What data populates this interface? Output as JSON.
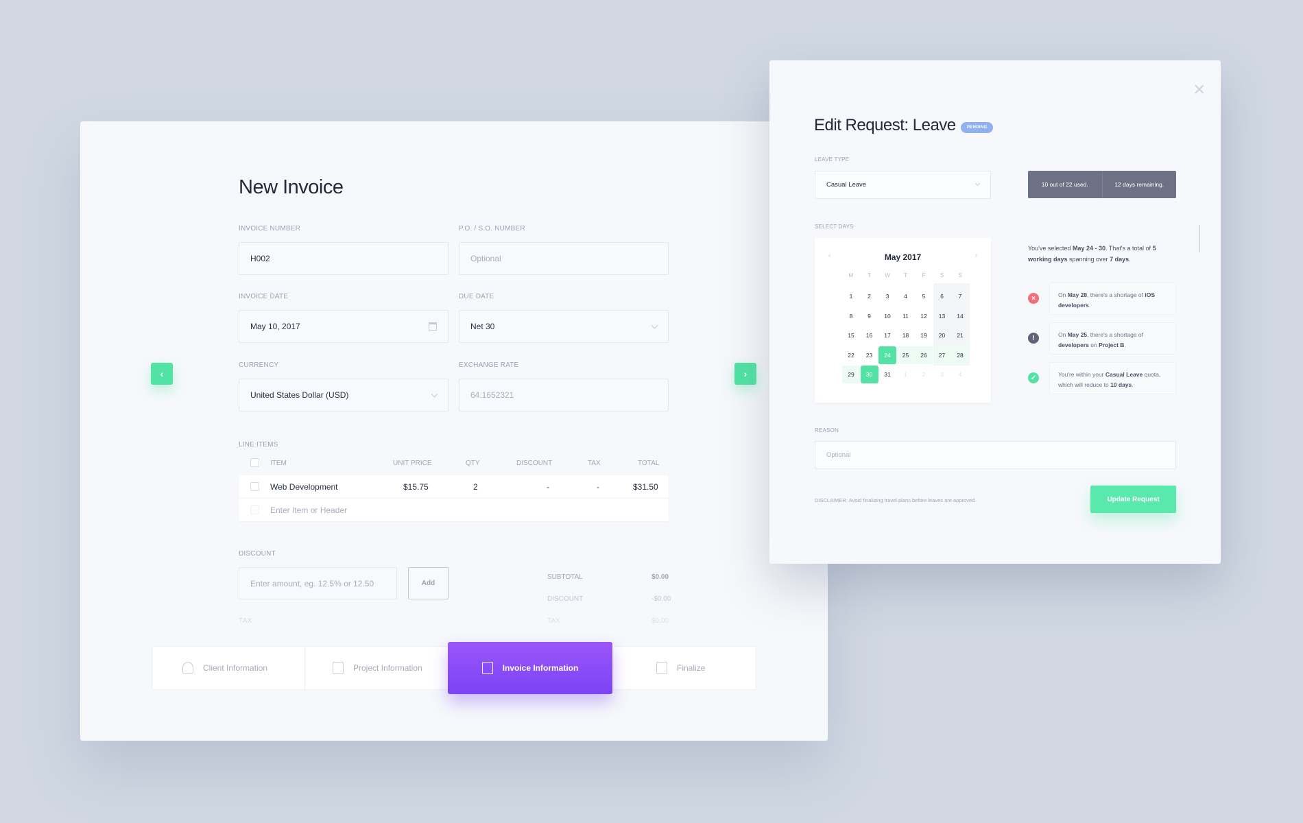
{
  "invoice": {
    "title": "New Invoice",
    "fields": {
      "invoice_number": {
        "label": "INVOICE NUMBER",
        "value": "H002"
      },
      "po_number": {
        "label": "P.O. / S.O. NUMBER",
        "placeholder": "Optional"
      },
      "invoice_date": {
        "label": "INVOICE DATE",
        "value": "May 10, 2017"
      },
      "due_date": {
        "label": "DUE DATE",
        "value": "Net 30"
      },
      "currency": {
        "label": "CURRENCY",
        "value": "United States Dollar (USD)"
      },
      "exchange_rate": {
        "label": "EXCHANGE RATE",
        "placeholder": "64.1652321"
      }
    },
    "line_items": {
      "label": "LINE ITEMS",
      "columns": [
        "ITEM",
        "UNIT PRICE",
        "QTY",
        "DISCOUNT",
        "TAX",
        "TOTAL"
      ],
      "rows": [
        {
          "item": "Web Development",
          "unit_price": "$15.75",
          "qty": "2",
          "discount": "-",
          "tax": "-",
          "total": "$31.50"
        }
      ],
      "new_placeholder": "Enter Item or Header"
    },
    "discount": {
      "label": "DISCOUNT",
      "placeholder": "Enter amount, eg. 12.5% or 12.50",
      "add_label": "Add",
      "tax_label": "TAX"
    },
    "totals": [
      {
        "label": "SUBTOTAL",
        "value": "$0.00"
      },
      {
        "label": "DISCOUNT",
        "value": "-$0.00"
      },
      {
        "label": "TAX",
        "value": "$0.00"
      }
    ],
    "nav": {
      "prev": "‹",
      "next": "›"
    },
    "steps": [
      {
        "label": "Client Information",
        "icon": "user-icon"
      },
      {
        "label": "Project Information",
        "icon": "clipboard-icon"
      },
      {
        "label": "Invoice Information",
        "icon": "receipt-icon",
        "active": true
      },
      {
        "label": "Finalize",
        "icon": "checklist-icon"
      }
    ]
  },
  "leave": {
    "title": "Edit Request: Leave",
    "badge": "PENDING",
    "leave_type": {
      "label": "LEAVE TYPE",
      "value": "Casual Leave"
    },
    "quota": {
      "used": "10 out of 22 used.",
      "remaining": "12 days remaining."
    },
    "select_days_label": "SELECT DAYS",
    "calendar": {
      "month": "May 2017",
      "weekdays": [
        "M",
        "T",
        "W",
        "T",
        "F",
        "S",
        "S"
      ],
      "selected_start": 24,
      "selected_end": 30
    },
    "summary": {
      "p1": "You've selected ",
      "range": "May 24 - 30",
      "p2": ". That's a total of ",
      "working": "5 working days",
      "p3": " spanning over ",
      "span": "7 days",
      "p4": "."
    },
    "notes": [
      {
        "type": "error",
        "html": "On <b>May 28</b>, there's a shortage of <b>iOS developers</b>.",
        "color": "#f0707a",
        "glyph": "×"
      },
      {
        "type": "warning",
        "html": "On <b>May 25</b>, there's a shortage of <b>developers</b> on <b>Project B</b>.",
        "color": "#5f6478",
        "glyph": "!"
      },
      {
        "type": "success",
        "html": "You're within your <b>Casual Leave</b> quota, which will reduce to <b>10 days</b>.",
        "color": "#52e3a4",
        "glyph": "✓"
      }
    ],
    "reason": {
      "label": "REASON",
      "placeholder": "Optional"
    },
    "disclaimer": "DISCLAIMER:  Avoid finalizing travel plans before leaves are approved.",
    "update_label": "Update Request",
    "close": "×"
  }
}
